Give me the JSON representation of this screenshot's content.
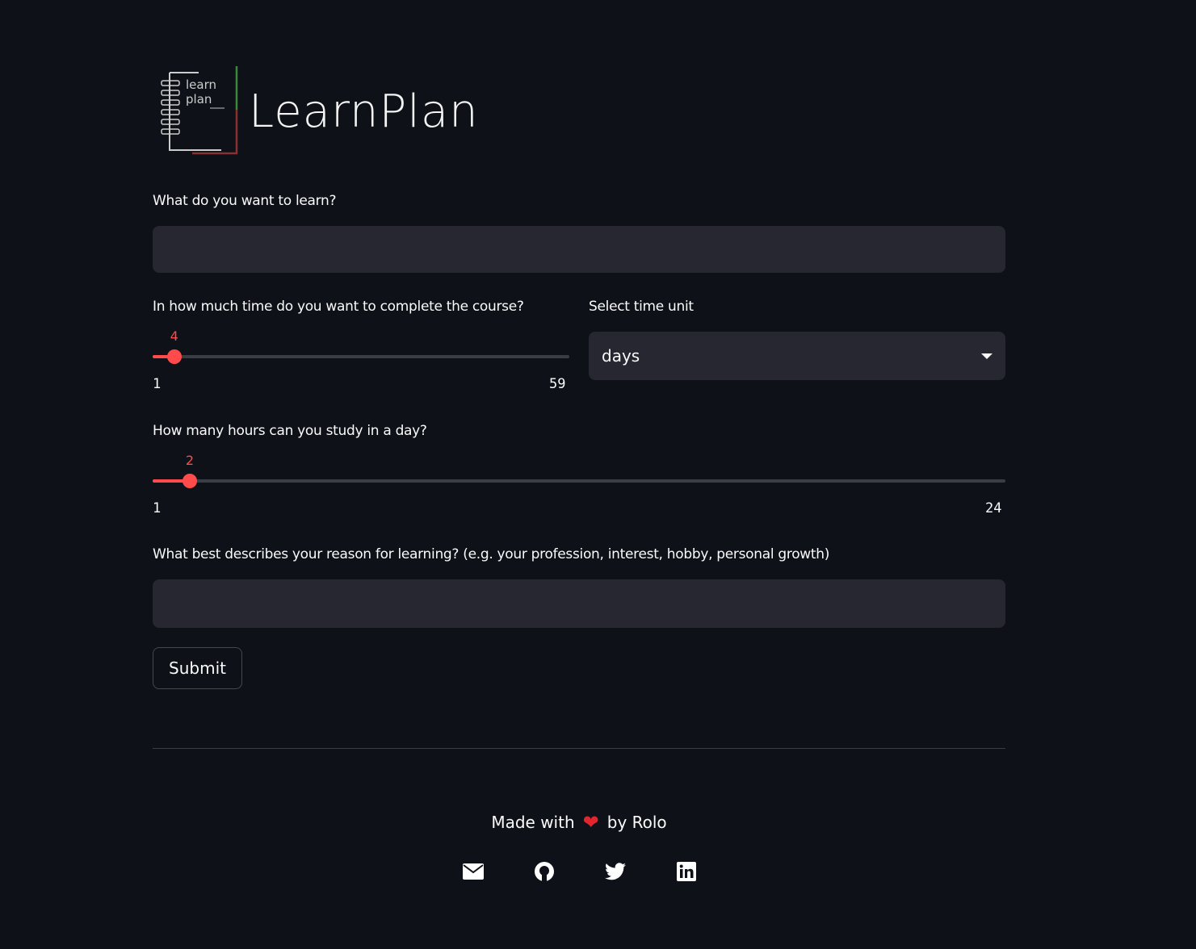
{
  "logo": {
    "icon_text": [
      "learn",
      "plan"
    ],
    "title": "LearnPlan"
  },
  "form": {
    "topic": {
      "label": "What do you want to learn?",
      "value": "",
      "placeholder": ""
    },
    "duration": {
      "label": "In how much time do you want to complete the course?",
      "value": 4,
      "min": 1,
      "max": 59,
      "min_label": "1",
      "max_label": "59",
      "value_label": "4"
    },
    "time_unit": {
      "label": "Select time unit",
      "selected": "days"
    },
    "hours": {
      "label": "How many hours can you study in a day?",
      "value": 2,
      "min": 1,
      "max": 24,
      "min_label": "1",
      "max_label": "24",
      "value_label": "2"
    },
    "reason": {
      "label": "What best describes your reason for learning? (e.g. your profession, interest, hobby, personal growth)",
      "value": "",
      "placeholder": ""
    },
    "submit_label": "Submit"
  },
  "footer": {
    "made_with": "Made with",
    "by": "by Rolo",
    "icons": [
      "envelope-icon",
      "github-icon",
      "twitter-icon",
      "linkedin-icon"
    ]
  },
  "colors": {
    "background": "#0e1117",
    "input": "#262730",
    "accent": "#ff4b4b"
  }
}
